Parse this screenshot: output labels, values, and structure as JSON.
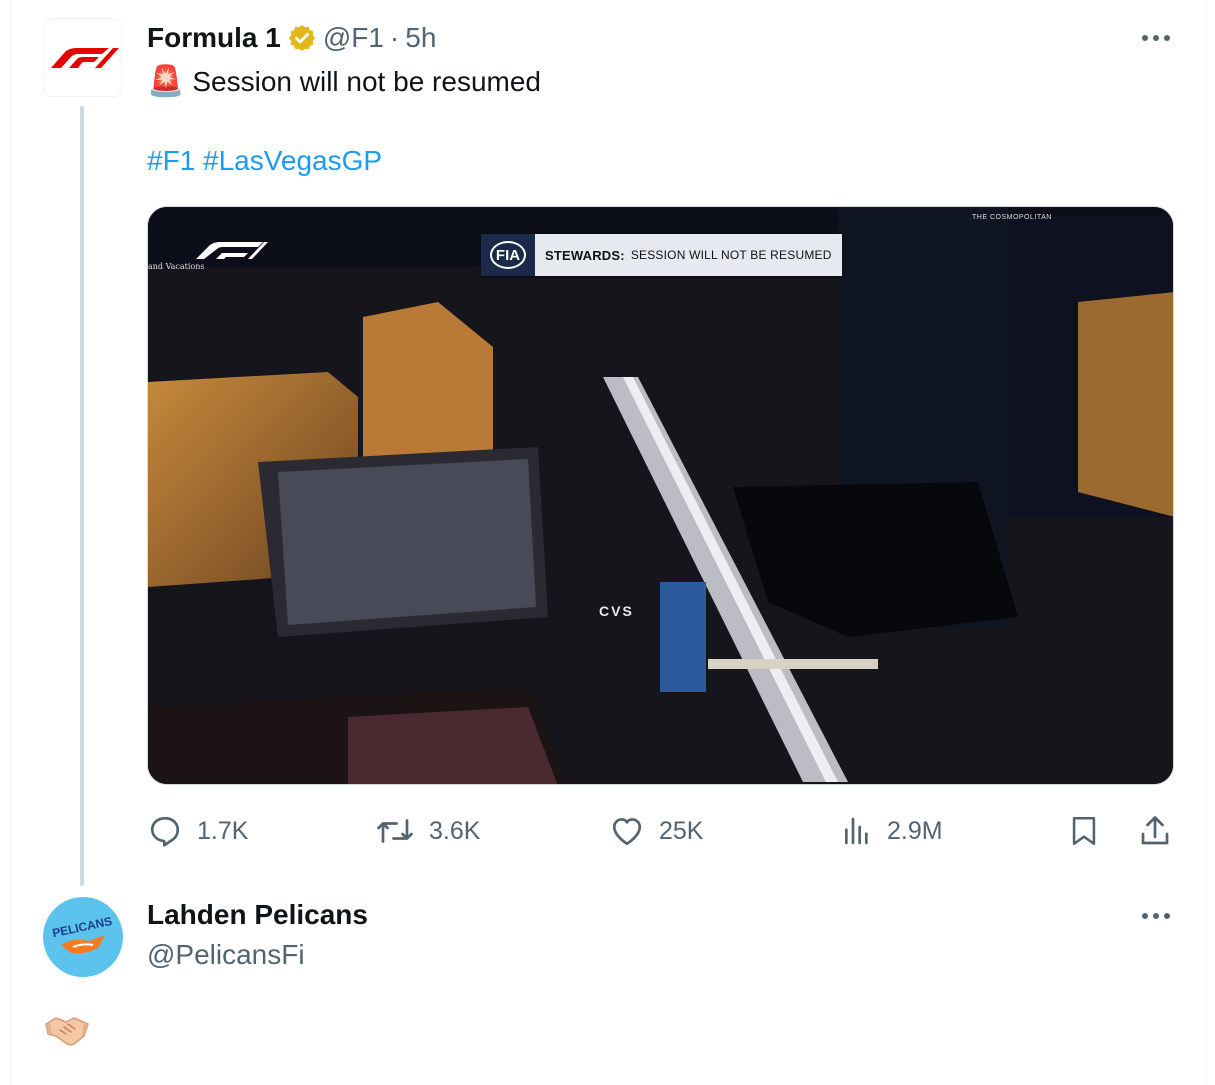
{
  "tweet": {
    "author_name": "Formula 1",
    "handle": "@F1",
    "separator": "·",
    "time": "5h",
    "emoji": "🚨",
    "text": "Session will not be resumed",
    "hashtags": [
      "#F1",
      "#LasVegasGP"
    ],
    "media": {
      "ticker_org": "FIA",
      "ticker_bold": "STEWARDS:",
      "ticker_text": "SESSION WILL NOT BE RESUMED",
      "sign_cosmopolitan": "THE COSMOPOLITAN",
      "sign_vacations": "and Vacations",
      "sign_cvs": "CVS"
    },
    "stats": {
      "replies": "1.7K",
      "reposts": "3.6K",
      "likes": "25K",
      "views": "2.9M"
    }
  },
  "reply": {
    "author_name": "Lahden Pelicans",
    "handle": "@PelicansFi",
    "avatar_text": "PELICANS",
    "body_icon": "handshake-icon"
  },
  "colors": {
    "link": "#1d9bf0",
    "muted": "#536471",
    "verified": "#e2b719",
    "f1_red": "#e10600"
  }
}
